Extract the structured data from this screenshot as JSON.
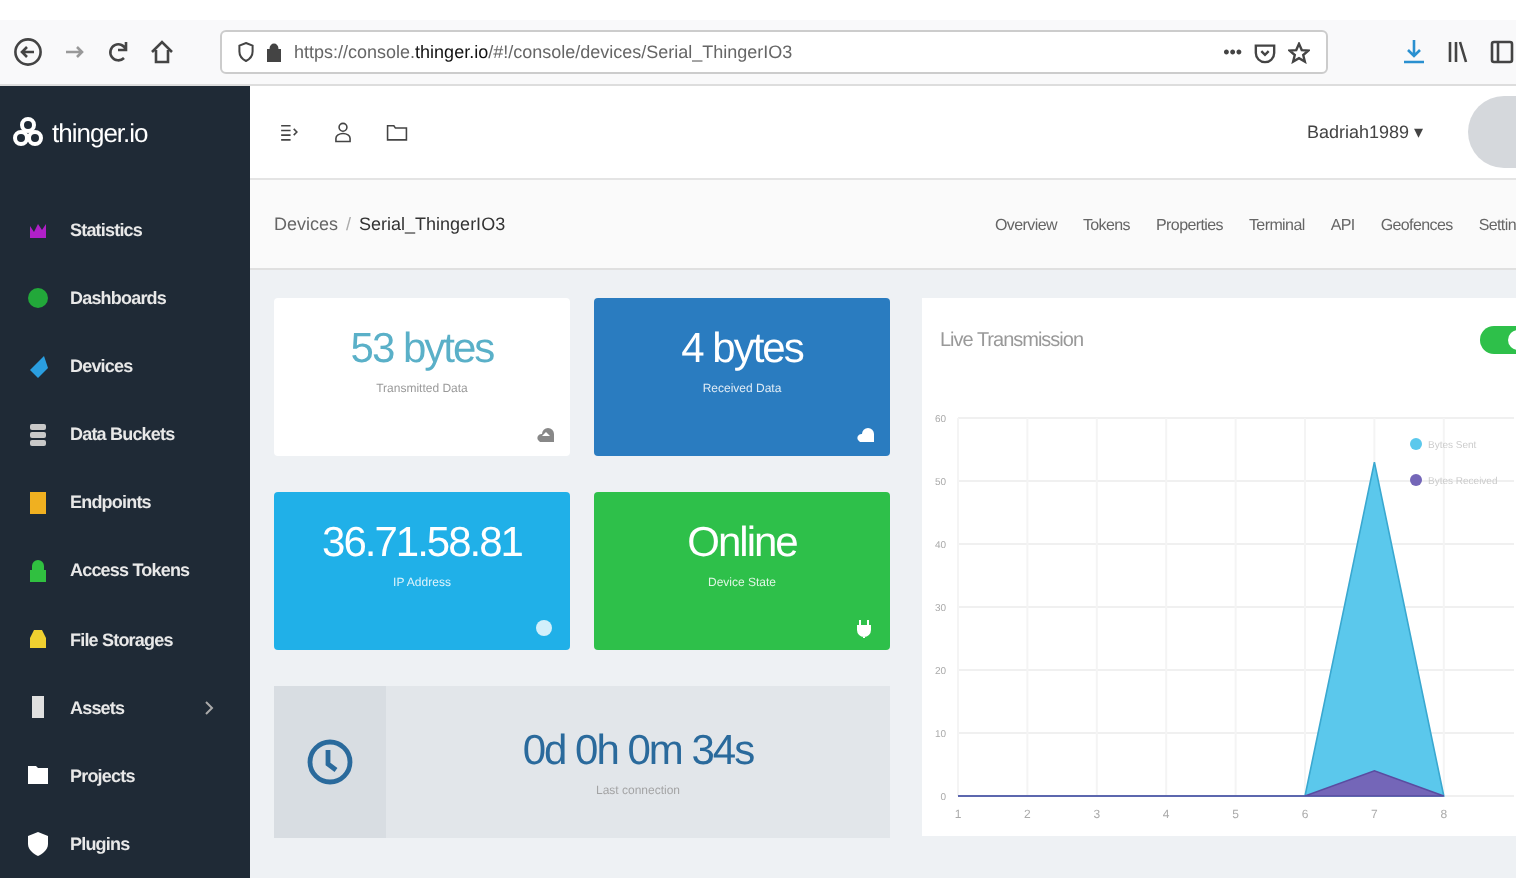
{
  "browser": {
    "url": "https://console.**thinger.io**/#!/console/devices/Serial_ThingerIO3",
    "more": "•••"
  },
  "sidebar": {
    "logo": "thinger.io",
    "items": [
      {
        "label": "Statistics",
        "color": "#b020c8",
        "has_submenu": false
      },
      {
        "label": "Dashboards",
        "color": "#22a83a",
        "has_submenu": false
      },
      {
        "label": "Devices",
        "color": "#2a9ee0",
        "has_submenu": false
      },
      {
        "label": "Data Buckets",
        "color": "#c8c8c8",
        "has_submenu": false
      },
      {
        "label": "Endpoints",
        "color": "#f0b020",
        "has_submenu": false
      },
      {
        "label": "Access Tokens",
        "color": "#30c040",
        "has_submenu": false
      },
      {
        "label": "File Storages",
        "color": "#f0d030",
        "has_submenu": false
      },
      {
        "label": "Assets",
        "color": "#e0e0e0",
        "has_submenu": true
      },
      {
        "label": "Projects",
        "color": "#ffffff",
        "has_submenu": false
      },
      {
        "label": "Plugins",
        "color": "#ffffff",
        "has_submenu": false
      }
    ]
  },
  "header": {
    "user": "Badriah1989",
    "caret": "▾"
  },
  "breadcrumb": {
    "items": [
      "Devices",
      "Serial_ThingerIO3"
    ],
    "separator": "/"
  },
  "tabs": [
    {
      "label": "Overview",
      "selected": false
    },
    {
      "label": "Tokens",
      "selected": false
    },
    {
      "label": "Properties",
      "selected": false
    },
    {
      "label": "Terminal",
      "selected": false
    },
    {
      "label": "API",
      "selected": false
    },
    {
      "label": "Geofences",
      "selected": false
    },
    {
      "label": "Settin",
      "selected": false
    }
  ],
  "stats": [
    {
      "value": "53 bytes",
      "label": "Transmitted Data",
      "color": "#ffffff"
    },
    {
      "value": "4 bytes",
      "label": "Received Data",
      "color": "#2a7cc0"
    },
    {
      "value": "36.71.58.81",
      "label": "IP Address",
      "color": "#20b0e8"
    },
    {
      "value": "Online",
      "label": "Device State",
      "color": "#2ec04a"
    }
  ],
  "uptime": {
    "value": "0d 0h 0m 34s",
    "label": "Last connection"
  },
  "live": {
    "title": "Live Transmission",
    "on": true,
    "chart_data": {
      "type": "area",
      "categories": [
        "1",
        "2",
        "3",
        "4",
        "5",
        "6",
        "7",
        "8"
      ],
      "series": [
        {
          "name": "Bytes Sent",
          "color": "#5bc8ec",
          "values": [
            0,
            0,
            0,
            0,
            0,
            0,
            53,
            0
          ]
        },
        {
          "name": "Bytes Received",
          "color": "#7466b8",
          "values": [
            0,
            0,
            0,
            0,
            0,
            0,
            4,
            0
          ]
        }
      ],
      "ylim": [
        0,
        60
      ],
      "yticks": [
        0,
        10,
        20,
        30,
        40,
        50,
        60
      ],
      "grid": true,
      "legend": true
    }
  }
}
